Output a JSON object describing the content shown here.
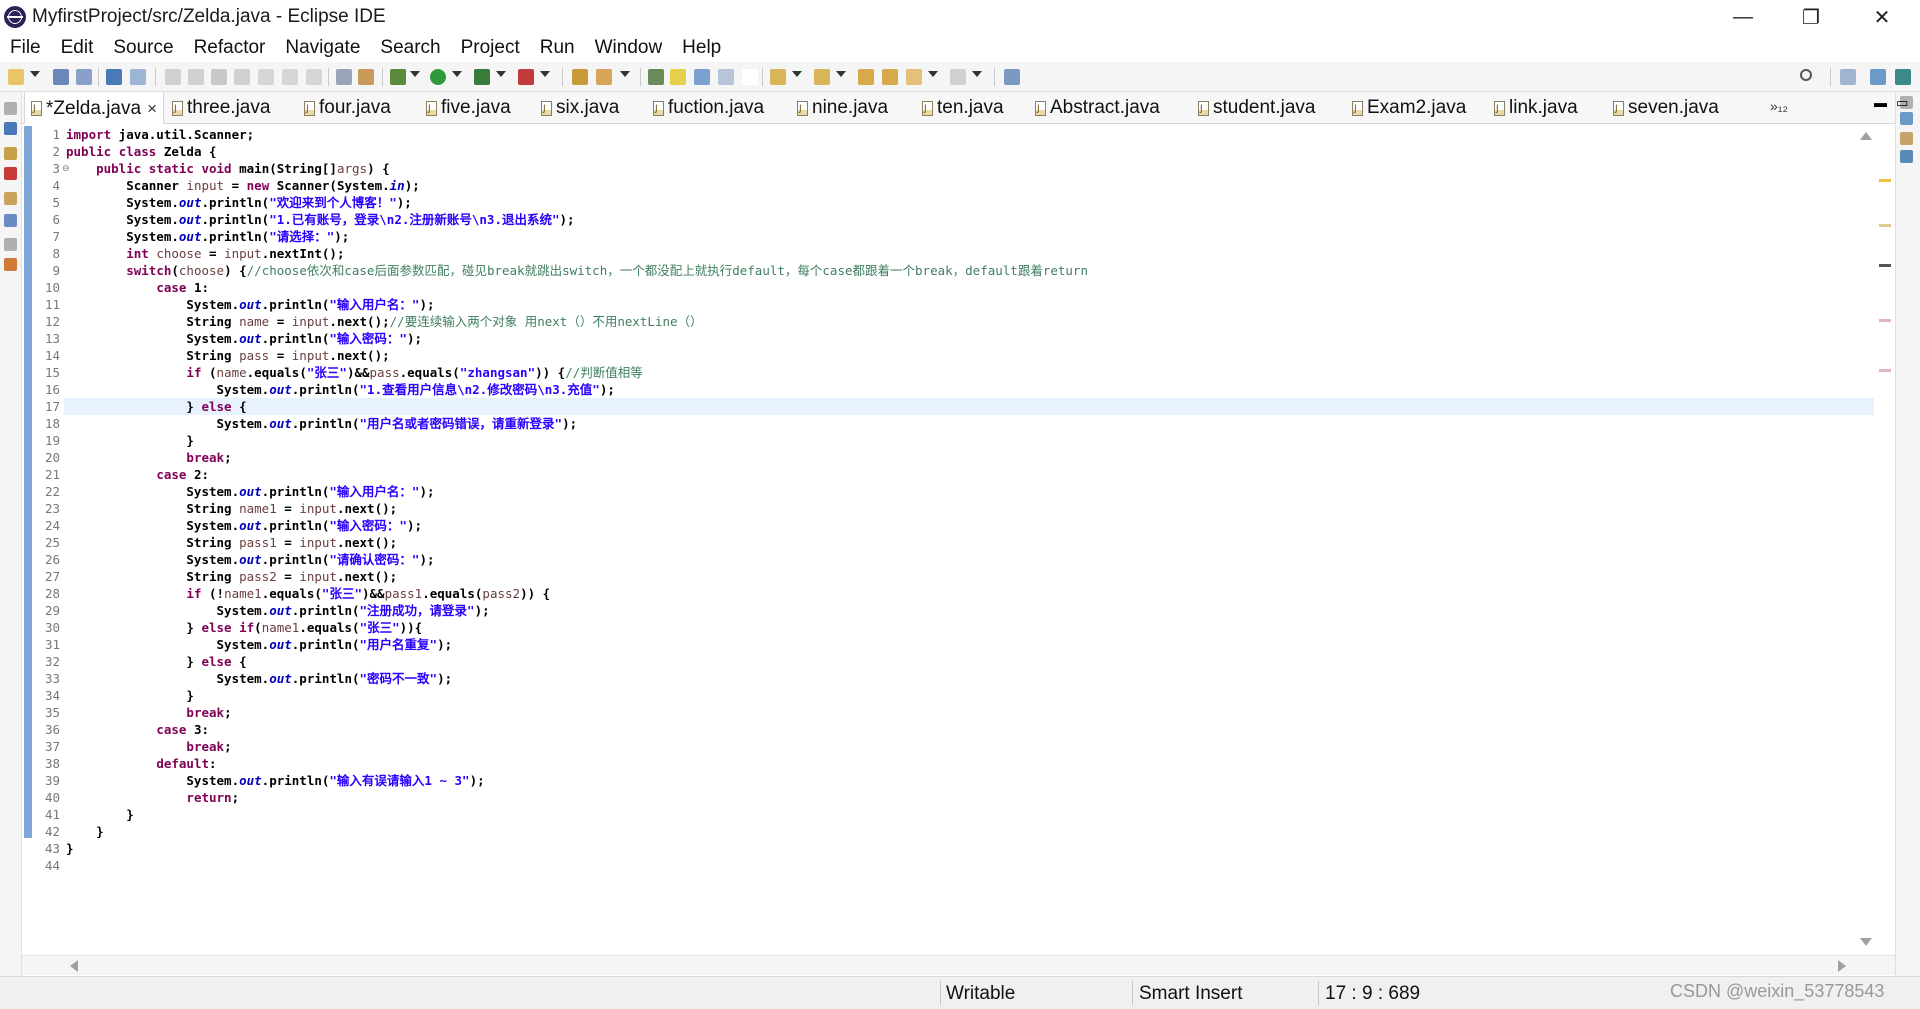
{
  "window": {
    "title": "MyfirstProject/src/Zelda.java - Eclipse IDE",
    "minimize": "—",
    "maximize": "❐",
    "close": "✕"
  },
  "menu": [
    "File",
    "Edit",
    "Source",
    "Refactor",
    "Navigate",
    "Search",
    "Project",
    "Run",
    "Window",
    "Help"
  ],
  "tabs": [
    {
      "label": "*Zelda.java",
      "active": true,
      "close": "×"
    },
    {
      "label": "three.java"
    },
    {
      "label": "four.java"
    },
    {
      "label": "five.java"
    },
    {
      "label": "six.java"
    },
    {
      "label": "fuction.java"
    },
    {
      "label": "nine.java"
    },
    {
      "label": "ten.java"
    },
    {
      "label": "Abstract.java"
    },
    {
      "label": "student.java"
    },
    {
      "label": "Exam2.java"
    },
    {
      "label": "link.java"
    },
    {
      "label": "seven.java"
    }
  ],
  "tab_overflow": "»₁₂",
  "tab_controls": {
    "minimize": "▬",
    "maximize": "▭"
  },
  "editor": {
    "current_line": 17,
    "lines": [
      "import java.util.Scanner;",
      "public class Zelda {",
      "    public static void main(String[]args) {",
      "        Scanner input = new Scanner(System.in);",
      "        System.out.println(\"欢迎来到个人博客！\");",
      "        System.out.println(\"1.已有账号，登录\\n2.注册新账号\\n3.退出系统\");",
      "        System.out.println(\"请选择：\");",
      "        int choose = input.nextInt();",
      "        switch(choose) {//choose依次和case后面参数匹配，碰见break就跳出switch，一个都没配上就执行default，每个case都跟着一个break，default跟着return",
      "            case 1:",
      "                System.out.println(\"输入用户名：\");",
      "                String name = input.next();//要连续输入两个对象 用next（）不用nextLine（）",
      "                System.out.println(\"输入密码：\");",
      "                String pass = input.next();",
      "                if (name.equals(\"张三\")&&pass.equals(\"zhangsan\")) {//判断值相等",
      "                    System.out.println(\"1.查看用户信息\\n2.修改密码\\n3.充值\");",
      "                } else {",
      "                    System.out.println(\"用户名或者密码错误，请重新登录\");",
      "                }",
      "                break;",
      "            case 2:",
      "                System.out.println(\"输入用户名：\");",
      "                String name1 = input.next();",
      "                System.out.println(\"输入密码：\");",
      "                String pass1 = input.next();",
      "                System.out.println(\"请确认密码：\");",
      "                String pass2 = input.next();",
      "                if (!name1.equals(\"张三\")&&pass1.equals(pass2)) {",
      "                    System.out.println(\"注册成功，请登录\");",
      "                } else if(name1.equals(\"张三\")){",
      "                    System.out.println(\"用户名重复\");",
      "                } else {",
      "                    System.out.println(\"密码不一致\");",
      "                }",
      "                break;",
      "            case 3:",
      "                break;",
      "            default:",
      "                System.out.println(\"输入有误请输入1 ~ 3\");",
      "                return;",
      "        }",
      "    }",
      "}",
      ""
    ]
  },
  "status": {
    "writable": "Writable",
    "insert_mode": "Smart Insert",
    "position": "17 : 9 : 689"
  },
  "watermark": "CSDN @weixin_53778543",
  "colors": {
    "keyword": "#7f0055",
    "string": "#2a00ff",
    "comment": "#3f7f5f",
    "field_italic": "#0000c0",
    "local_var": "#6a3e3e",
    "change_ruler": "#7ea7d8",
    "current_line_bg": "#e8f2fe"
  }
}
